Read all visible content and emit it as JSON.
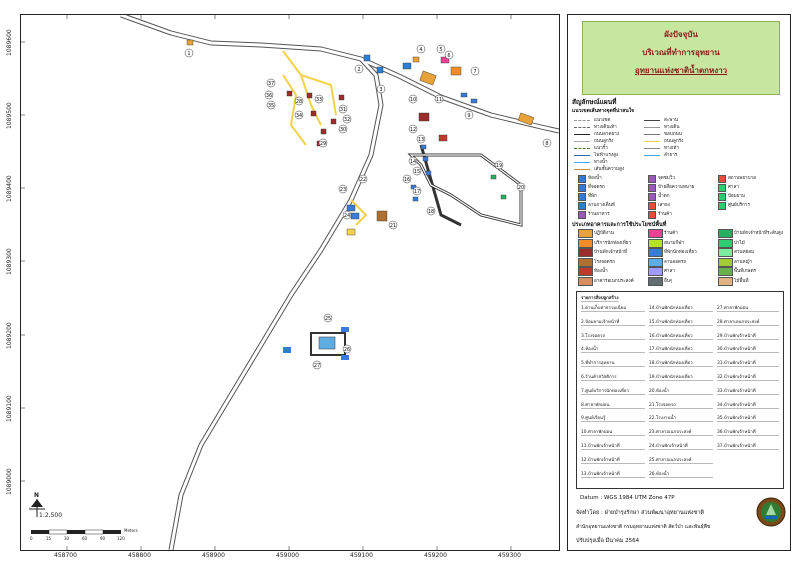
{
  "map": {
    "grid_x_ticks": [
      "458700",
      "458800",
      "458900",
      "459000",
      "459100",
      "459200",
      "459300"
    ],
    "grid_y_ticks": [
      "1089600",
      "1089500",
      "1089400",
      "1089300",
      "1089200",
      "1089100",
      "1089000"
    ],
    "scale_text": "1:2,500",
    "scale_ticks": [
      "0",
      "15",
      "30",
      "60",
      "90",
      "120"
    ],
    "scale_unit": "Meters",
    "north_label": "N",
    "site_numbers": [
      "1",
      "2",
      "3",
      "4",
      "5",
      "6",
      "7",
      "8",
      "9",
      "10",
      "11",
      "12",
      "13",
      "14",
      "15",
      "16",
      "17",
      "18",
      "19",
      "20",
      "21",
      "22",
      "23",
      "24",
      "25",
      "26",
      "27",
      "28",
      "29",
      "30",
      "31",
      "32",
      "33",
      "34",
      "35",
      "36",
      "37"
    ]
  },
  "panel": {
    "title1": "ผังปัจจุบัน",
    "title2": "บริเวณที่ทำการอุทยาน",
    "title3": "อุทยานแห่งชาติน้ำตกหงาว",
    "legend_heading": "สัญลักษณ์แผนที่",
    "legend_sub": "แนวเขตเส้นทางจุดที่น่าสนใจ",
    "line_items": [
      {
        "label": "แนวเขต",
        "color": "#999999",
        "dash": true
      },
      {
        "label": "ทางเดินเท้า",
        "color": "#666666",
        "dash": true
      },
      {
        "label": "ถนนลาดยาง",
        "color": "#222222",
        "dash": false
      },
      {
        "label": "ถนนลูกรัง",
        "color": "#aaaaaa",
        "dash": false
      },
      {
        "label": "แนวรั้ว",
        "color": "#4a7a2a",
        "dash": true
      },
      {
        "label": "ไฟฟ้าแรงสูง",
        "color": "#2b6ab8",
        "dash": false
      },
      {
        "label": "ทางน้ำ",
        "color": "#3fa9f5",
        "dash": false
      },
      {
        "label": "เส้นชั้นความสูง",
        "color": "#c68a3a",
        "dash": false
      }
    ],
    "line_items2": [
      {
        "label": "สะพาน",
        "color": "#444444"
      },
      {
        "label": "ทางเดิน",
        "color": "#999999"
      },
      {
        "label": "ขอบถนน",
        "color": "#777777"
      },
      {
        "label": "ถนนลูกรัง",
        "color": "#f2d24a"
      },
      {
        "label": "ทางเท้า",
        "color": "#888888"
      },
      {
        "label": "ลำธาร",
        "color": "#49a0e0"
      }
    ],
    "icon_items": [
      {
        "label": "ห้องน้ำ",
        "color": "#2b7fd4"
      },
      {
        "label": "ที่จอดรถ",
        "color": "#2b7fd4"
      },
      {
        "label": "ที่พัก",
        "color": "#2b7fd4"
      },
      {
        "label": "ลานกางเต็นท์",
        "color": "#2b7fd4"
      },
      {
        "label": "ร้านอาหาร",
        "color": "#9b59b6"
      },
      {
        "label": "จุดชมวิว",
        "color": "#9b59b6"
      },
      {
        "label": "ป้ายสื่อความหมาย",
        "color": "#9b59b6"
      },
      {
        "label": "น้ำตก",
        "color": "#9b59b6"
      },
      {
        "label": "เสาธง",
        "color": "#e74c3c"
      },
      {
        "label": "ร้านค้า",
        "color": "#e74c3c"
      },
      {
        "label": "สถานพยาบาล",
        "color": "#e74c3c"
      },
      {
        "label": "ศาลา",
        "color": "#2ecc71"
      },
      {
        "label": "ป้อมยาม",
        "color": "#2ecc71"
      },
      {
        "label": "ศูนย์บริการ",
        "color": "#2ecc71"
      }
    ],
    "landuse_heading": "ประเภทอาคารและการใช้ประโยชน์พื้นที่",
    "landuse": [
      {
        "label": "ปฏิบัติงาน",
        "color": "#e8a23a"
      },
      {
        "label": "บริการนักท่องเที่ยว",
        "color": "#f28c28"
      },
      {
        "label": "บ้านพักเจ้าหน้าที่",
        "color": "#9b2d2d"
      },
      {
        "label": "โรงจอดรถ",
        "color": "#b07030"
      },
      {
        "label": "ห้องน้ำ",
        "color": "#c0392b"
      },
      {
        "label": "อาคารอเนกประสงค์",
        "color": "#d98c5f"
      },
      {
        "label": "ร้านค้า",
        "color": "#e84393"
      },
      {
        "label": "สนามกีฬา",
        "color": "#b5e61d"
      },
      {
        "label": "ที่พักนักท่องเที่ยว",
        "color": "#3a7bd5"
      },
      {
        "label": "ลานจอดรถ",
        "color": "#5dade2"
      },
      {
        "label": "ศาลา",
        "color": "#a29bfe"
      },
      {
        "label": "อื่นๆ",
        "color": "#636e72"
      },
      {
        "label": "บ้านพักเจ้าหน้าที่ระดับสูง",
        "color": "#27ae60"
      },
      {
        "label": "ป่าไม้",
        "color": "#2ecc71"
      },
      {
        "label": "สวนหย่อม",
        "color": "#7bed9f"
      },
      {
        "label": "ลานหญ้า",
        "color": "#a3cb38"
      },
      {
        "label": "พื้นที่เกษตร",
        "color": "#6ab04c"
      },
      {
        "label": "ไม้พื้นที่",
        "color": "#e1b382"
      }
    ],
    "table_heading": "รายการสิ่งปลูกสร้าง",
    "table_col1": [
      "1.ด่านเก็บค่าธรรมเนียม",
      "2.ป้อมยามเจ้าหน้าที่",
      "3.โรงจอดรถ",
      "4.ห้องน้ำ",
      "5.ที่ทำการอุทยาน",
      "6.ร้านค้าสวัสดิการ",
      "7.ศูนย์บริการนักท่องเที่ยว",
      "8.ศาลาพักผ่อน",
      "9.ศูนย์เรียนรู้",
      "10.ศาลาพักผ่อน",
      "11.บ้านพักเจ้าหน้าที่",
      "12.บ้านพักเจ้าหน้าที่",
      "13.บ้านพักเจ้าหน้าที่"
    ],
    "table_col2": [
      "14.บ้านพักนักท่องเที่ยว",
      "15.บ้านพักนักท่องเที่ยว",
      "16.บ้านพักนักท่องเที่ยว",
      "17.บ้านพักนักท่องเที่ยว",
      "18.บ้านพักนักท่องเที่ยว",
      "19.บ้านพักนักท่องเที่ยว",
      "20.ห้องน้ำ",
      "21.โรงจอดรถ",
      "22.โรงงานน้ำ",
      "23.ศาลาอเนกประสงค์",
      "24.บ้านพักเจ้าหน้าที่",
      "25.ศาลาอเนกประสงค์",
      "26.ห้องน้ำ"
    ],
    "table_col3": [
      "27.ศาลาพักผ่อน",
      "28.ศาลาเอนกประสงค์",
      "29.บ้านพักเจ้าหน้าที่",
      "30.บ้านพักเจ้าหน้าที่",
      "31.บ้านพักเจ้าหน้าที่",
      "32.บ้านพักเจ้าหน้าที่",
      "33.บ้านพักเจ้าหน้าที่",
      "34.บ้านพักเจ้าหน้าที่",
      "35.บ้านพักเจ้าหน้าที่",
      "36.บ้านพักเจ้าหน้าที่",
      "37.บ้านพักเจ้าหน้าที่"
    ],
    "datum": "Datum : WGS 1984 UTM Zone 47P",
    "made_by": "จัดทำโดย : ฝ่ายบำรุงรักษา ส่วนพัฒนาอุทยานแห่งชาติ",
    "org": "สำนักอุทยานแห่งชาติ กรมอุทยานแห่งชาติ สัตว์ป่า และพันธุ์พืช",
    "updated": "ปรับปรุงเมื่อ มีนาคม 2564"
  }
}
